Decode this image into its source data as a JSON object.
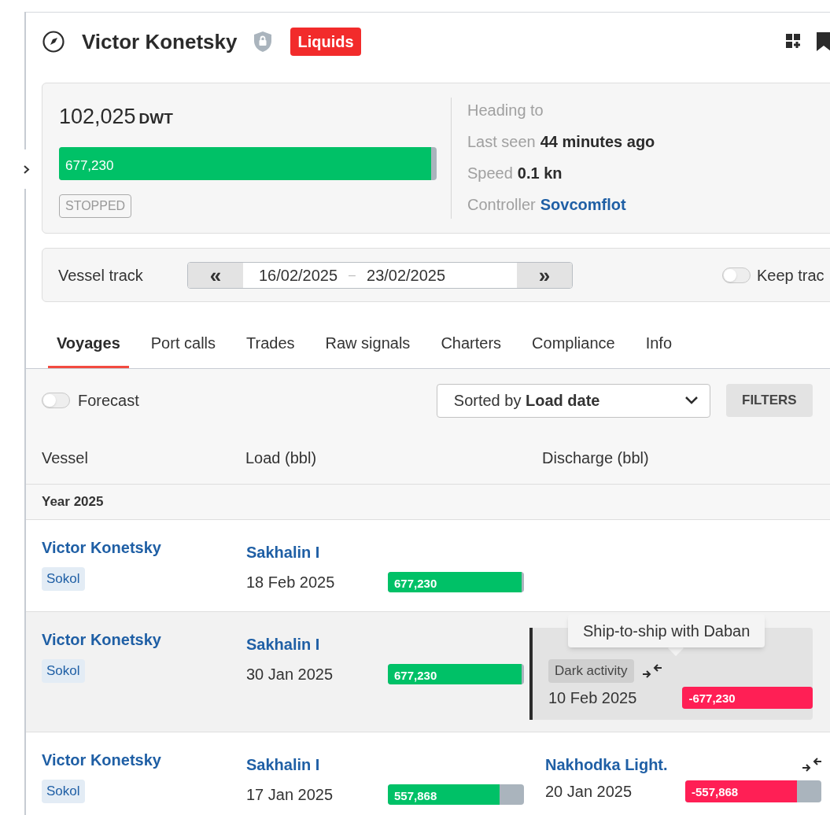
{
  "vessel": {
    "name": "Victor Konetsky",
    "tag": "Liquids"
  },
  "summary": {
    "dwt": "102,025",
    "dwt_unit": "DWT",
    "cargo": {
      "value": "677,230",
      "level": 0.985
    },
    "status": "STOPPED",
    "details": [
      {
        "label": "Heading to"
      },
      {
        "label": "Last seen",
        "value": "44 minutes ago",
        "kind": "text"
      },
      {
        "label": "Speed",
        "value": "0.1 kn",
        "kind": "text"
      },
      {
        "label": "Controller",
        "value": "Sovcomflot",
        "kind": "link"
      }
    ]
  },
  "track": {
    "label": "Vessel track",
    "prev": "«",
    "from": "16/02/2025",
    "separator": "–",
    "to": "23/02/2025",
    "next": "»",
    "keep": {
      "label": "Keep trac",
      "on": false
    }
  },
  "tabs": [
    {
      "label": "Voyages",
      "selected": true
    },
    {
      "label": "Port calls",
      "selected": false
    },
    {
      "label": "Trades",
      "selected": false
    },
    {
      "label": "Raw signals",
      "selected": false
    },
    {
      "label": "Charters",
      "selected": false
    },
    {
      "label": "Compliance",
      "selected": false
    },
    {
      "label": "Info",
      "selected": false
    }
  ],
  "toolbar": {
    "forecast": {
      "label": "Forecast",
      "on": false
    },
    "sort": {
      "prefix": "Sorted by",
      "value": "Load date"
    },
    "filters": "FILTERS"
  },
  "table": {
    "columns": [
      "Vessel",
      "Load (bbl)",
      "Discharge (bbl)"
    ],
    "group": "Year 2025",
    "rows": [
      {
        "vessel": "Victor Konetsky",
        "tag": "Sokol",
        "selected": false,
        "load": {
          "port": "Sakhalin I",
          "date": "18 Feb 2025",
          "amount": "677,230",
          "level": 0.98
        }
      },
      {
        "vessel": "Victor Konetsky",
        "tag": "Sokol",
        "selected": true,
        "load": {
          "port": "Sakhalin I",
          "date": "30 Jan 2025",
          "amount": "677,230",
          "level": 0.98
        },
        "discharge": {
          "badge": "Dark activity",
          "ship_to_ship": true,
          "date": "10 Feb 2025",
          "amount": "-677,230",
          "level": 1,
          "highlighted": true,
          "tooltip": "Ship-to-ship with Daban"
        }
      },
      {
        "vessel": "Victor Konetsky",
        "tag": "Sokol",
        "selected": false,
        "load": {
          "port": "Sakhalin I",
          "date": "17 Jan 2025",
          "amount": "557,868",
          "level": 0.82
        },
        "discharge": {
          "port": "Nakhodka Light.",
          "ship_to_ship": true,
          "date": "20 Jan 2025",
          "amount": "-557,868",
          "level": 0.82,
          "highlighted": false
        }
      }
    ]
  }
}
